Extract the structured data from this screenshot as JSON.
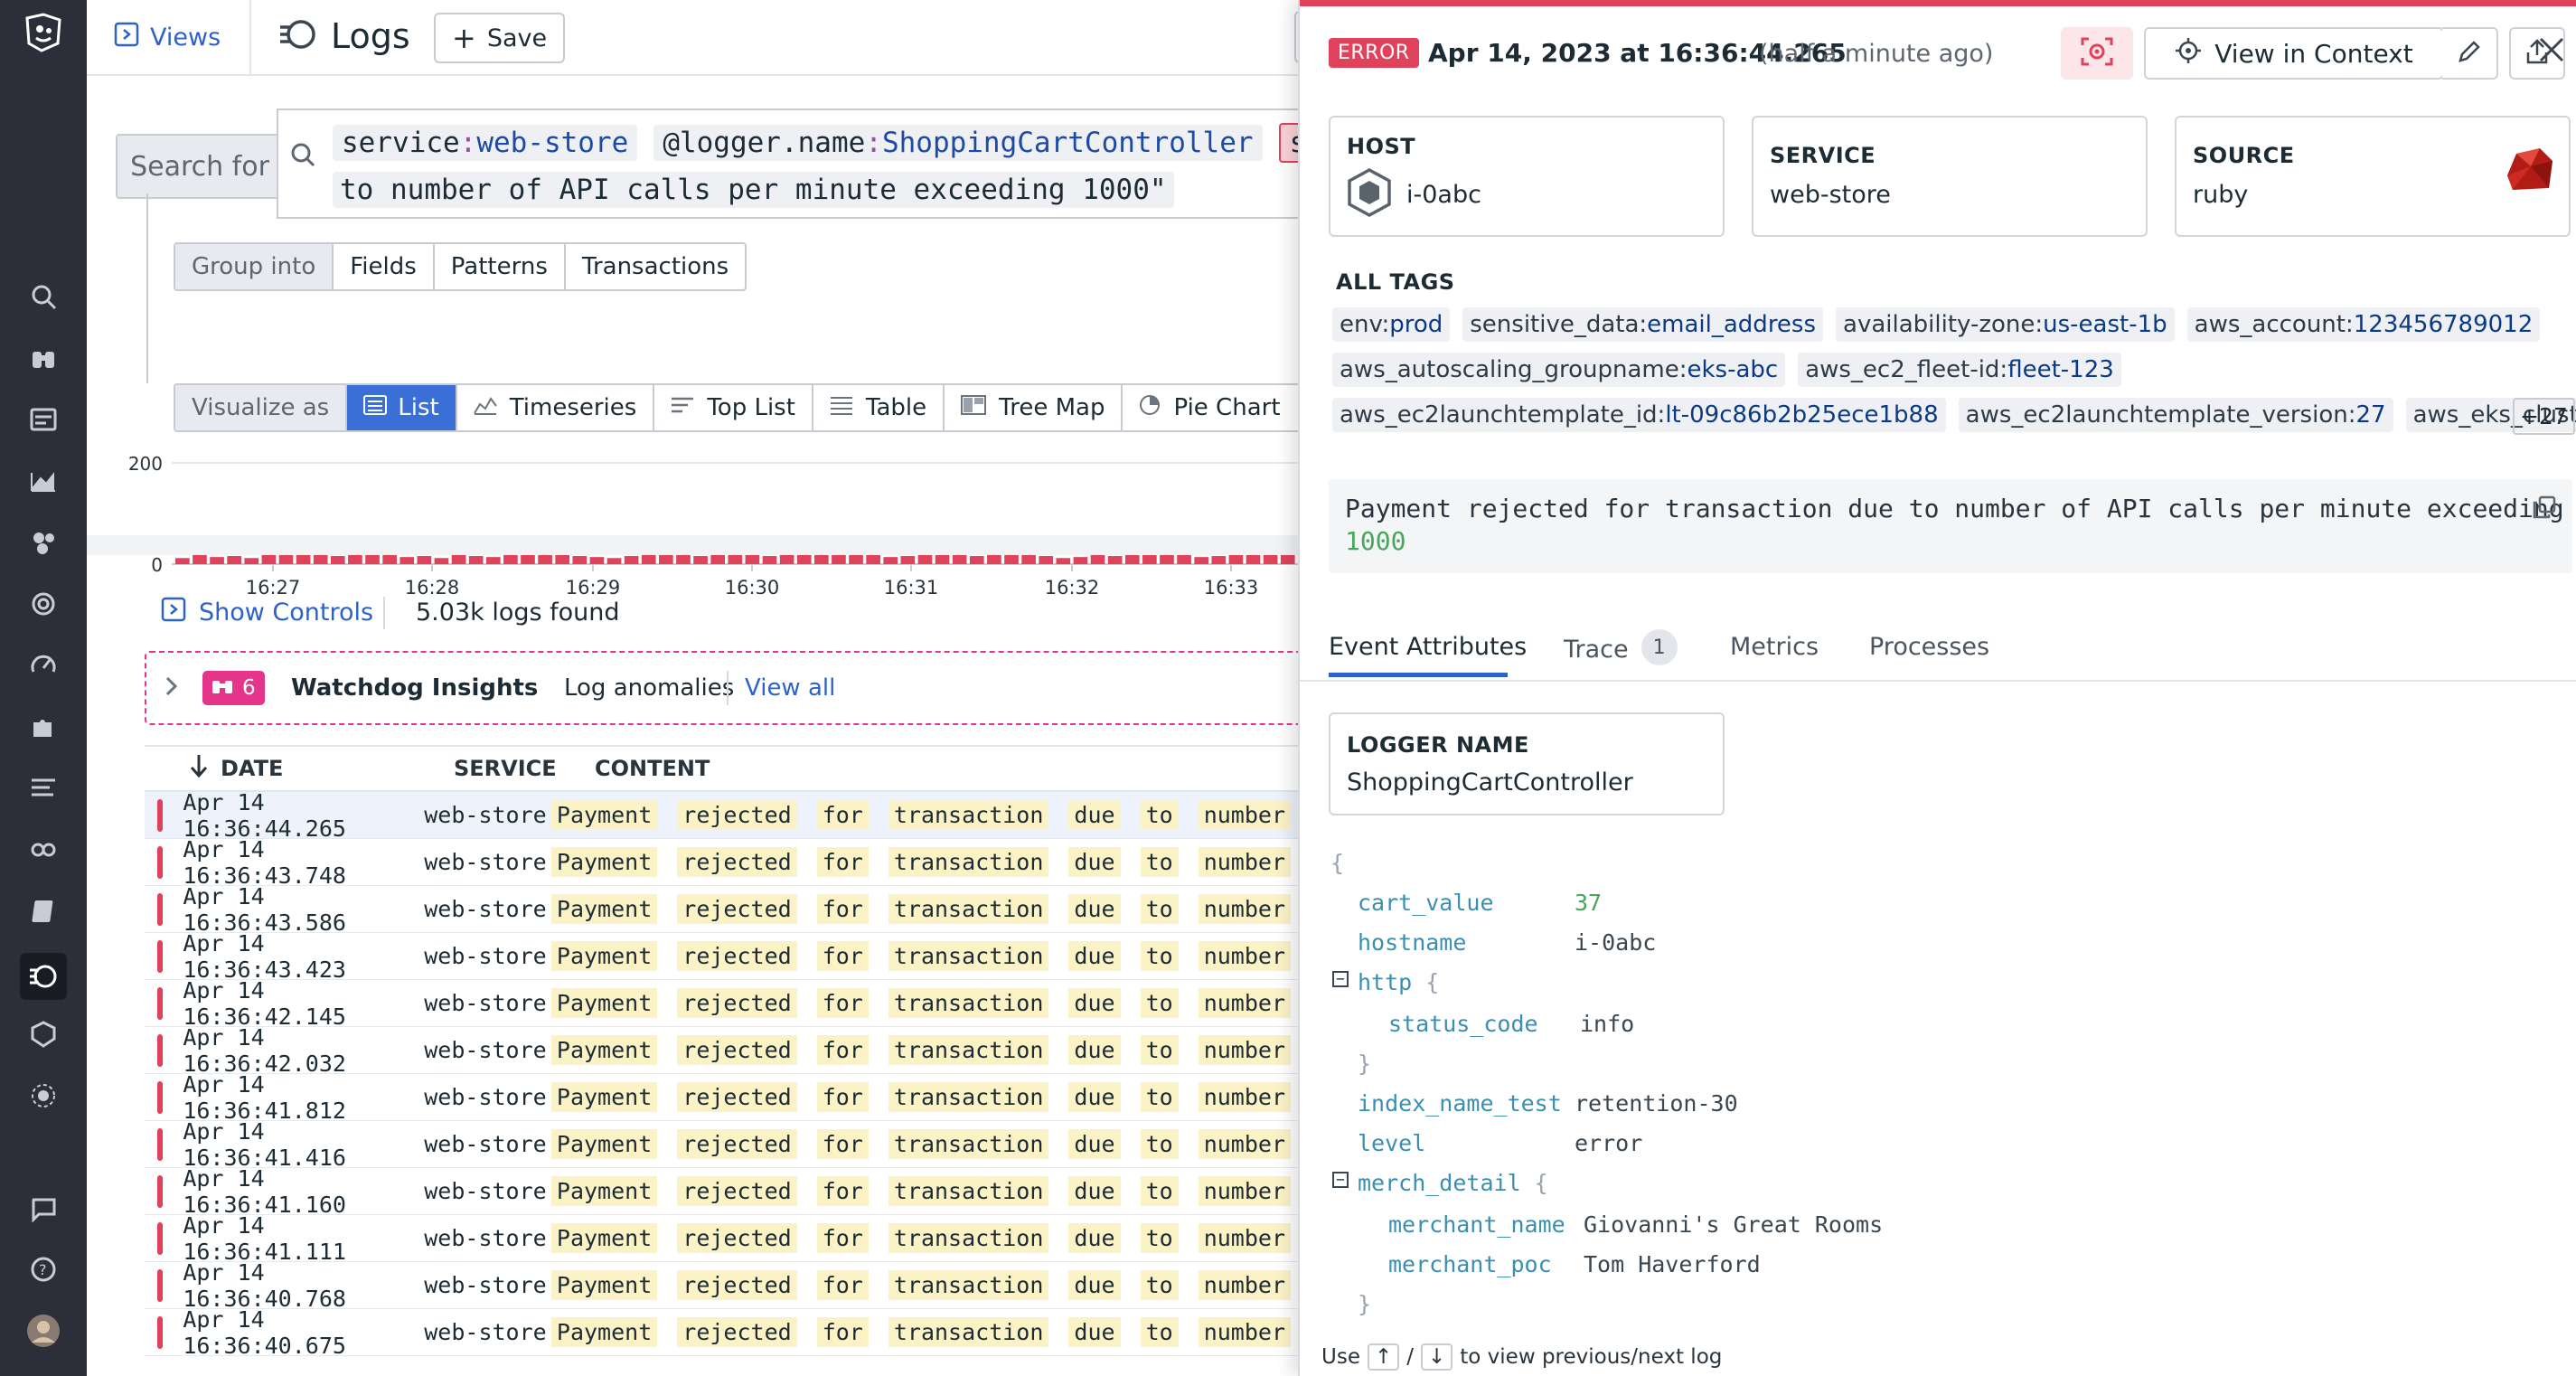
{
  "topbar": {
    "views_label": "Views",
    "title": "Logs",
    "save_label": "Save"
  },
  "search": {
    "label": "Search for",
    "query_line1_tokens": [
      {
        "k": "service",
        "v": "web-store"
      },
      {
        "k": "@logger.name",
        "v": "ShoppingCartController"
      }
    ],
    "query_trunc": "st",
    "query_line2": "to number of API calls per minute exceeding 1000\""
  },
  "group_into": {
    "label": "Group into",
    "options": [
      "Fields",
      "Patterns",
      "Transactions"
    ]
  },
  "visualize": {
    "label": "Visualize as",
    "options": [
      "List",
      "Timeseries",
      "Top List",
      "Table",
      "Tree Map",
      "Pie Chart"
    ],
    "selected": "List"
  },
  "chart_data": {
    "type": "bar",
    "ylim": [
      0,
      200
    ],
    "yticks": [
      "200",
      "0"
    ],
    "xticks": [
      "16:27",
      "16:28",
      "16:29",
      "16:30",
      "16:31",
      "16:32",
      "16:33"
    ],
    "values": [
      12,
      18,
      14,
      16,
      12,
      18,
      22,
      22,
      18,
      16,
      20,
      22,
      18,
      14,
      16,
      12,
      18,
      16,
      14,
      18,
      22,
      20,
      18,
      16,
      14,
      12,
      16,
      18,
      20,
      18,
      16,
      18,
      22,
      20,
      16,
      18,
      22,
      20,
      24,
      22,
      18,
      14,
      16,
      20,
      18,
      22,
      16,
      18,
      20,
      18,
      16,
      12,
      14,
      18,
      16,
      20,
      22,
      20,
      18,
      14,
      16,
      20,
      18,
      22,
      24
    ]
  },
  "controls": {
    "show_controls": "Show Controls",
    "logs_found": "5.03k logs found"
  },
  "watchdog": {
    "count": "6",
    "title": "Watchdog Insights",
    "subtitle": "Log anomalies",
    "view_all": "View all"
  },
  "table": {
    "headers": [
      "DATE",
      "SERVICE",
      "CONTENT"
    ],
    "rows": [
      {
        "date": "Apr 14 16:36:44.265",
        "service": "web-store"
      },
      {
        "date": "Apr 14 16:36:43.748",
        "service": "web-store"
      },
      {
        "date": "Apr 14 16:36:43.586",
        "service": "web-store"
      },
      {
        "date": "Apr 14 16:36:43.423",
        "service": "web-store"
      },
      {
        "date": "Apr 14 16:36:42.145",
        "service": "web-store"
      },
      {
        "date": "Apr 14 16:36:42.032",
        "service": "web-store"
      },
      {
        "date": "Apr 14 16:36:41.812",
        "service": "web-store"
      },
      {
        "date": "Apr 14 16:36:41.416",
        "service": "web-store"
      },
      {
        "date": "Apr 14 16:36:41.160",
        "service": "web-store"
      },
      {
        "date": "Apr 14 16:36:41.111",
        "service": "web-store"
      },
      {
        "date": "Apr 14 16:36:40.768",
        "service": "web-store"
      },
      {
        "date": "Apr 14 16:36:40.675",
        "service": "web-store"
      }
    ],
    "content_words": [
      "Payment",
      "rejected",
      "for",
      "transaction",
      "due",
      "to",
      "number"
    ]
  },
  "panel": {
    "status": "ERROR",
    "timestamp": "Apr 14, 2023 at 16:36:44.265",
    "relative": "(half a minute ago)",
    "view_in_context": "View in Context",
    "host": {
      "label": "HOST",
      "value": "i-0abc"
    },
    "service": {
      "label": "SERVICE",
      "value": "web-store"
    },
    "source": {
      "label": "SOURCE",
      "value": "ruby"
    },
    "all_tags_label": "ALL TAGS",
    "tags": [
      [
        {
          "k": "env:",
          "v": "prod"
        },
        {
          "k": "sensitive_data:",
          "v": "email_address"
        },
        {
          "k": "availability-zone:",
          "v": "us-east-1b"
        },
        {
          "k": "aws_account:",
          "v": "123456789012"
        }
      ],
      [
        {
          "k": "aws_autoscaling_groupname:",
          "v": "eks-abc"
        },
        {
          "k": "aws_ec2_fleet-id:",
          "v": "fleet-123"
        }
      ],
      [
        {
          "k": "aws_ec2launchtemplate_id:",
          "v": "lt-09c86b2b25ece1b88"
        },
        {
          "k": "aws_ec2launchtemplate_version:",
          "v": "27"
        },
        {
          "k": "aws_eks_clust...",
          "v": ""
        }
      ]
    ],
    "more_tags": "+27",
    "message_line1": "Payment rejected for transaction due to number of API calls per minute exceeding",
    "message_line2": "1000",
    "tabs": [
      {
        "label": "Event Attributes"
      },
      {
        "label": "Trace",
        "badge": "1"
      },
      {
        "label": "Metrics"
      },
      {
        "label": "Processes"
      }
    ],
    "logger": {
      "label": "LOGGER NAME",
      "value": "ShoppingCartController"
    },
    "attrs": {
      "cart_value": "37",
      "hostname": "i-0abc",
      "http": "http",
      "status_code": "info",
      "index_name_test": "retention-30",
      "level": "error",
      "merch_detail": "merch_detail",
      "merchant_name": "Giovanni's Great Rooms",
      "merchant_poc": "Tom Haverford"
    },
    "footer": {
      "use": "Use",
      "up": "↑",
      "slash": "/",
      "down": "↓",
      "rest": "to view previous/next log"
    }
  },
  "colors": {
    "error": "#e0425b",
    "accent": "#3a6fd8",
    "nav_bg": "#2c2f3a",
    "tag_value": "#0b3a84",
    "watchdog": "#e5358a"
  }
}
